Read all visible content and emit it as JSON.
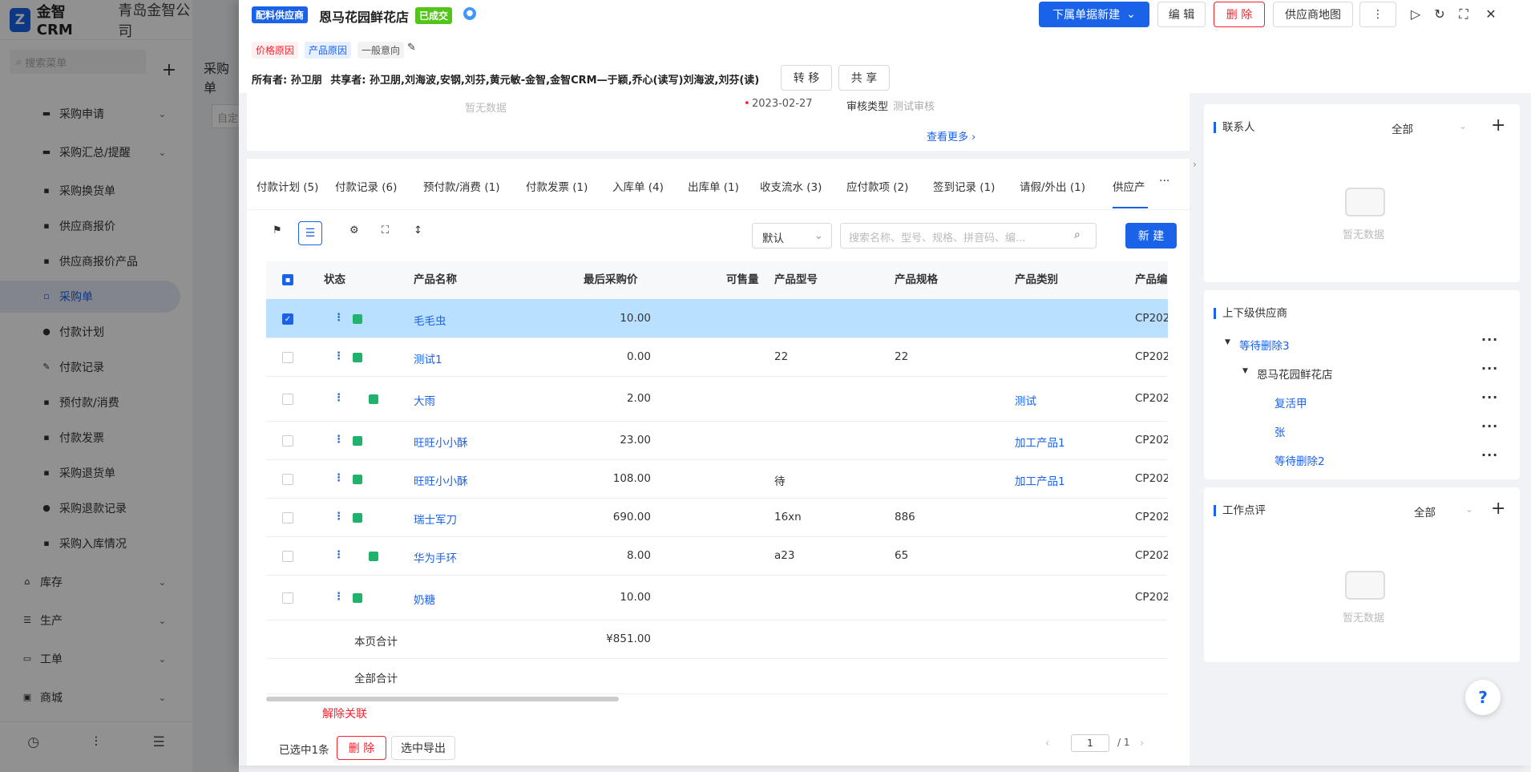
{
  "app": {
    "logo_mark": "Z",
    "name": "金智CRM",
    "company": "青岛金智公司",
    "search_placeholder": "搜索菜单"
  },
  "sidebar": {
    "items": [
      {
        "label": "采购申请",
        "icon": "folder-icon",
        "chevron": true
      },
      {
        "label": "采购汇总/提醒",
        "icon": "folder-icon",
        "chevron": true
      },
      {
        "label": "采购换货单",
        "icon": "doc-icon"
      },
      {
        "label": "供应商报价",
        "icon": "doc-icon"
      },
      {
        "label": "供应商报价产品",
        "icon": "doc-icon"
      },
      {
        "label": "采购单",
        "icon": "doc-icon",
        "active": true
      },
      {
        "label": "付款计划",
        "icon": "clock-icon"
      },
      {
        "label": "付款记录",
        "icon": "edit-icon"
      },
      {
        "label": "预付款/消费",
        "icon": "money-icon"
      },
      {
        "label": "付款发票",
        "icon": "invoice-icon"
      },
      {
        "label": "采购退货单",
        "icon": "doc-icon"
      },
      {
        "label": "采购退款记录",
        "icon": "refund-icon"
      },
      {
        "label": "采购入库情况",
        "icon": "doc-icon"
      }
    ],
    "groups": [
      {
        "label": "库存",
        "icon": "store-icon"
      },
      {
        "label": "生产",
        "icon": "production-icon"
      },
      {
        "label": "工单",
        "icon": "ticket-icon"
      },
      {
        "label": "商城",
        "icon": "shop-icon"
      }
    ]
  },
  "background_page": {
    "title": "采购单",
    "filter_placeholder": "自定"
  },
  "header": {
    "type_badge": "配料供应商",
    "title": "恩马花园鲜花店",
    "status_badge": "已成交",
    "tags": [
      "价格原因",
      "产品原因",
      "一般意向"
    ],
    "owner_label": "所有者:",
    "owner": "孙卫朋",
    "share_label": "共享者:",
    "sharers": "孙卫朋,刘海波,安钢,刘芬,黄元敏-金智,金智CRM—于颖,乔心(读写)刘海波,刘芬(读)",
    "transfer_btn": "转 移",
    "share_btn": "共 享",
    "new_sub_btn": "下属单据新建",
    "edit_btn": "编 辑",
    "delete_btn": "删 除",
    "map_btn": "供应商地图"
  },
  "info_strip": {
    "no_data": "暂无数据",
    "date": "2023-02-27",
    "audit_type_label": "审核类型",
    "audit_type_value": "测试审核",
    "see_more": "查看更多"
  },
  "tabs": [
    {
      "label": "付款计划 (5)"
    },
    {
      "label": "付款记录 (6)"
    },
    {
      "label": "预付款/消费 (1)"
    },
    {
      "label": "付款发票 (1)"
    },
    {
      "label": "入库单 (4)"
    },
    {
      "label": "出库单 (1)"
    },
    {
      "label": "收支流水 (3)"
    },
    {
      "label": "应付款项 (2)"
    },
    {
      "label": "签到记录 (1)"
    },
    {
      "label": "请假/外出 (1)"
    },
    {
      "label": "供应产",
      "active": true
    }
  ],
  "toolbar": {
    "sort_value": "默认",
    "search_placeholder": "搜索名称、型号、规格、拼音码、编...",
    "new_btn": "新 建"
  },
  "table": {
    "headers": [
      "状态",
      "产品名称",
      "最后采购价",
      "可售量",
      "产品型号",
      "产品规格",
      "产品类别",
      "产品编号"
    ],
    "rows": [
      {
        "name": "毛毛虫",
        "price": "10.00",
        "model": "",
        "spec": "",
        "category": "",
        "code": "CP202",
        "selected": true
      },
      {
        "name": "测试1",
        "price": "0.00",
        "model": "22",
        "spec": "22",
        "category": "",
        "code": "CP202"
      },
      {
        "name": "大雨",
        "price": "2.00",
        "model": "",
        "spec": "",
        "category": "测试",
        "code": "CP202"
      },
      {
        "name": "旺旺小小酥",
        "price": "23.00",
        "model": "",
        "spec": "",
        "category": "加工产品1",
        "code": "CP202"
      },
      {
        "name": "旺旺小小酥",
        "price": "108.00",
        "model": "待",
        "spec": "",
        "category": "加工产品1",
        "code": "CP202"
      },
      {
        "name": "瑞士军刀",
        "price": "690.00",
        "model": "16xn",
        "spec": "886",
        "category": "",
        "code": "CP202"
      },
      {
        "name": "华为手环",
        "price": "8.00",
        "model": "a23",
        "spec": "65",
        "category": "",
        "code": "CP202"
      },
      {
        "name": "奶糖",
        "price": "10.00",
        "model": "",
        "spec": "",
        "category": "",
        "code": "CP202"
      }
    ],
    "page_total_label": "本页合计",
    "page_total": "¥851.00",
    "all_total_label": "全部合计"
  },
  "footer": {
    "unlink": "解除关联",
    "selected_count": "已选中1条",
    "delete_btn": "删 除",
    "export_btn": "选中导出",
    "page": "1",
    "total_pages": "/ 1"
  },
  "right_panel": {
    "contacts_title": "联系人",
    "contacts_filter": "全部",
    "no_data": "暂无数据",
    "parent_title": "上下级供应商",
    "tree": [
      {
        "label": "等待删除3",
        "level": 0,
        "link": true,
        "caret": true
      },
      {
        "label": "恩马花园鲜花店",
        "level": 1,
        "link": false,
        "caret": true
      },
      {
        "label": "复活甲",
        "level": 2,
        "link": true
      },
      {
        "label": "张",
        "level": 2,
        "link": true
      },
      {
        "label": "等待删除2",
        "level": 2,
        "link": true
      }
    ],
    "comments_title": "工作点评",
    "comments_filter": "全部"
  }
}
